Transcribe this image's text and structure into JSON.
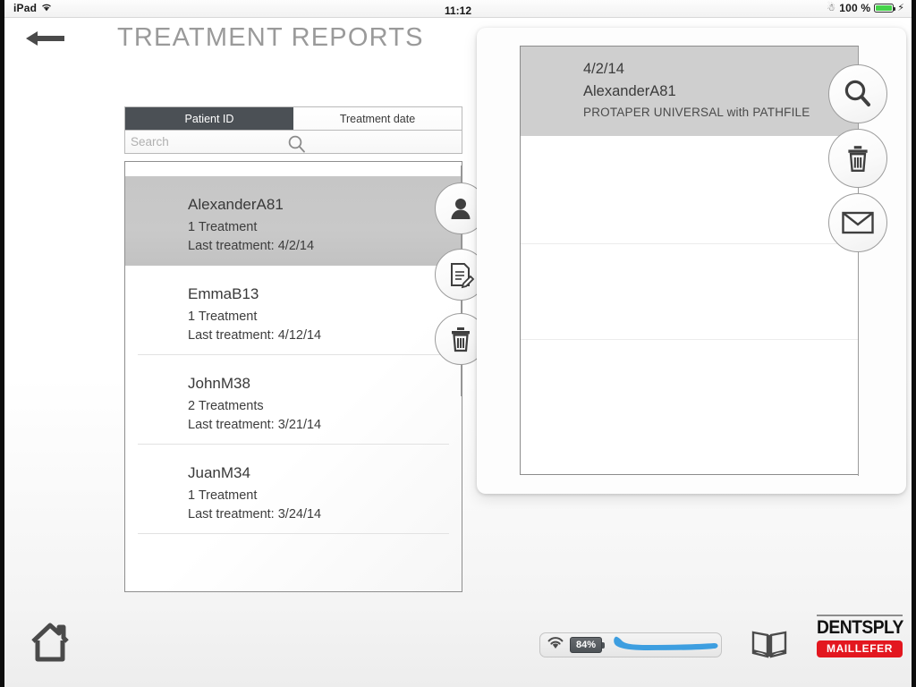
{
  "status_bar": {
    "device_label": "iPad",
    "wifi_icon": "wifi-icon",
    "time": "11:12",
    "bluetooth_icon": "bluetooth-icon",
    "battery_percent": "100 %",
    "battery_icon": "battery-full-icon",
    "charging_icon": "lightning-bolt-icon",
    "battery_color": "#45d34a"
  },
  "header": {
    "back_icon": "arrow-left-icon",
    "title": "TREATMENT REPORTS",
    "title_color": "#9a9a9a"
  },
  "list_panel": {
    "tabs": [
      {
        "label": "Patient ID",
        "active": true
      },
      {
        "label": "Treatment date",
        "active": false
      }
    ],
    "active_tab_color": "#4b5055",
    "search": {
      "placeholder": "Search",
      "value": "",
      "icon": "search-icon"
    },
    "patients": [
      {
        "name": "AlexanderA81",
        "treatments": "1 Treatment",
        "last_treatment": "Last treatment: 4/2/14",
        "selected": true
      },
      {
        "name": "EmmaB13",
        "treatments": "1 Treatment",
        "last_treatment": "Last treatment: 4/12/14",
        "selected": false
      },
      {
        "name": "JohnM38",
        "treatments": "2 Treatments",
        "last_treatment": "Last treatment: 3/21/14",
        "selected": false
      },
      {
        "name": "JuanM34",
        "treatments": "1 Treatment",
        "last_treatment": "Last treatment: 3/24/14",
        "selected": false
      }
    ],
    "actions": [
      {
        "icon": "user-icon",
        "name": "patient-profile-button"
      },
      {
        "icon": "document-edit-icon",
        "name": "edit-report-button"
      },
      {
        "icon": "trash-icon",
        "name": "delete-patient-button"
      }
    ]
  },
  "detail_panel": {
    "record": {
      "date": "4/2/14",
      "patient": "AlexanderA81",
      "treatment": "PROTAPER UNIVERSAL with PATHFILE"
    },
    "header_bg": "#cfcfcf",
    "empty_rows": 3,
    "actions": [
      {
        "icon": "search-icon",
        "name": "search-report-button"
      },
      {
        "icon": "trash-icon",
        "name": "delete-report-button"
      },
      {
        "icon": "envelope-icon",
        "name": "email-report-button"
      }
    ]
  },
  "bottom_bar": {
    "home_icon": "home-icon",
    "device_status": {
      "wifi_icon": "wifi-icon",
      "battery_percent": "84%",
      "handpiece_icon": "handpiece-icon",
      "handpiece_color": "#3d9ee0"
    },
    "book_icon": "book-icon",
    "logo": {
      "brand": "DENTSPLY",
      "sub_brand": "MAILLEFER",
      "sub_brand_bg": "#e3171f"
    }
  }
}
